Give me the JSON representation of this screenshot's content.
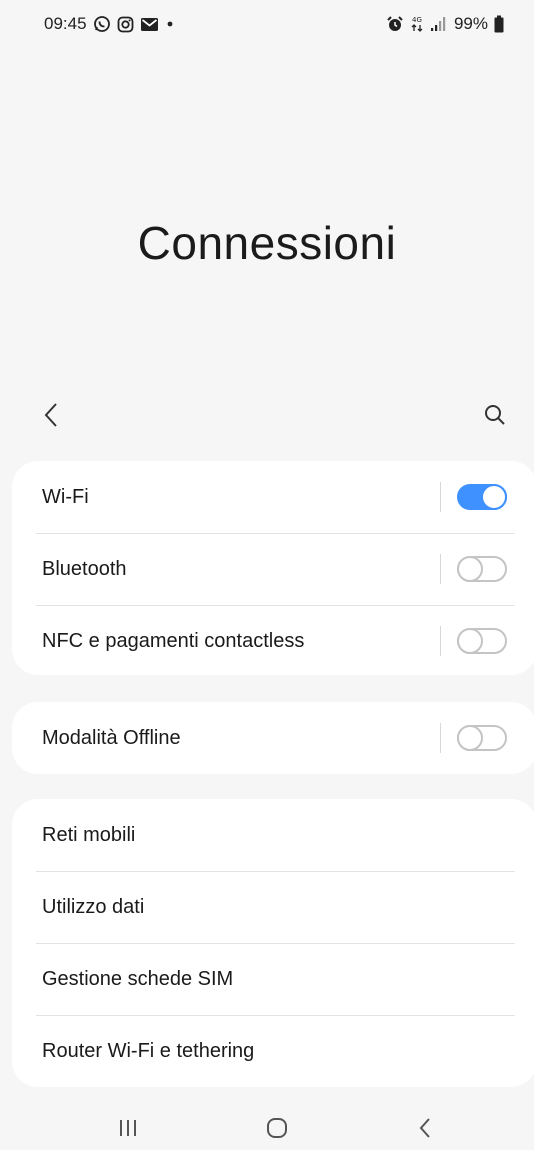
{
  "status_bar": {
    "time": "09:45",
    "network": "4G",
    "battery": "99%"
  },
  "page": {
    "title": "Connessioni"
  },
  "colors": {
    "accent": "#3e91ff",
    "background": "#f6f6f6",
    "card": "#ffffff"
  },
  "toggles_group": [
    {
      "label": "Wi-Fi",
      "on": true
    },
    {
      "label": "Bluetooth",
      "on": false
    },
    {
      "label": "NFC e pagamenti contactless",
      "on": false
    }
  ],
  "offline_group": [
    {
      "label": "Modalità Offline",
      "on": false
    }
  ],
  "links_group": [
    {
      "label": "Reti mobili"
    },
    {
      "label": "Utilizzo dati"
    },
    {
      "label": "Gestione schede SIM"
    },
    {
      "label": "Router Wi-Fi e tethering"
    }
  ],
  "icons": {
    "back": "chevron-left-icon",
    "search": "search-icon",
    "recents": "recents-icon",
    "home": "home-icon",
    "nav_back": "nav-back-icon"
  }
}
